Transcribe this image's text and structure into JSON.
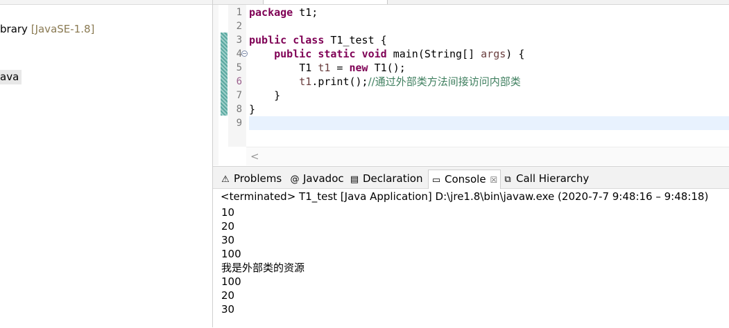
{
  "package_explorer": {
    "library_row": {
      "text": "brary",
      "hint": "[JavaSE-1.8]"
    },
    "java_row": {
      "text": "ava"
    }
  },
  "editor": {
    "line_numbers": [
      "1",
      "2",
      "3",
      "4",
      "5",
      "6",
      "7",
      "8",
      "9"
    ],
    "lines": [
      [
        {
          "t": "package",
          "c": "kw"
        },
        {
          "t": " t1;"
        }
      ],
      [],
      [
        {
          "t": "public",
          "c": "kw"
        },
        {
          "t": " "
        },
        {
          "t": "class",
          "c": "kw"
        },
        {
          "t": " T1_test {"
        }
      ],
      [
        {
          "t": "    "
        },
        {
          "t": "public",
          "c": "kw"
        },
        {
          "t": " "
        },
        {
          "t": "static",
          "c": "kw"
        },
        {
          "t": " "
        },
        {
          "t": "void",
          "c": "kw"
        },
        {
          "t": " main(String[] "
        },
        {
          "t": "args",
          "c": "lv"
        },
        {
          "t": ") {"
        }
      ],
      [
        {
          "t": "        T1 "
        },
        {
          "t": "t1",
          "c": "lv"
        },
        {
          "t": " = "
        },
        {
          "t": "new",
          "c": "kw"
        },
        {
          "t": " T1();"
        }
      ],
      [
        {
          "t": "        "
        },
        {
          "t": "t1",
          "c": "lv"
        },
        {
          "t": ".print();"
        },
        {
          "t": "//通过外部类方法间接访问内部类",
          "c": "cm"
        }
      ],
      [
        {
          "t": "    }"
        }
      ],
      [
        {
          "t": "}"
        }
      ],
      []
    ],
    "scroll_left_glyph": "<"
  },
  "views": {
    "tabs": [
      {
        "id": "problems",
        "label": "Problems",
        "icon": "problems-icon",
        "glyph": "⚠"
      },
      {
        "id": "javadoc",
        "label": "Javadoc",
        "icon": "javadoc-icon",
        "glyph": "@"
      },
      {
        "id": "declaration",
        "label": "Declaration",
        "icon": "declaration-icon",
        "glyph": "▤"
      },
      {
        "id": "console",
        "label": "Console",
        "icon": "console-icon",
        "glyph": "▭",
        "close": "☒"
      },
      {
        "id": "callhierarchy",
        "label": "Call Hierarchy",
        "icon": "call-hierarchy-icon",
        "glyph": "⧉"
      }
    ],
    "console": {
      "status": "<terminated> T1_test [Java Application] D:\\jre1.8\\bin\\javaw.exe  (2020-7-7 9:48:16 – 9:48:18)",
      "output": [
        "10",
        "20",
        "30",
        "100",
        "我是外部类的资源",
        "100",
        "20",
        "30"
      ]
    }
  },
  "colors": {
    "keyword": "#7f0055",
    "local_var": "#6a3e3e",
    "comment": "#3f7f5f",
    "current_line": "#e8f2fe"
  }
}
